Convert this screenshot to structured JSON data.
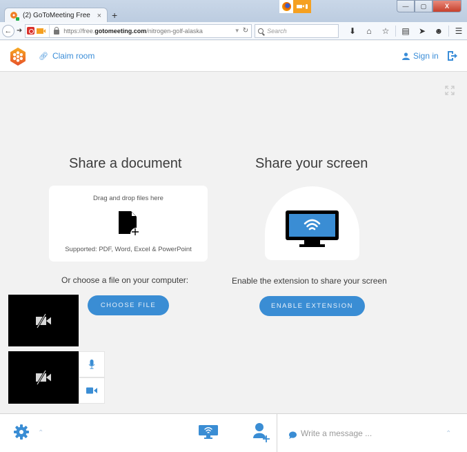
{
  "browser": {
    "tab_title": "(2) GoToMeeting Free",
    "tab_close": "×",
    "new_tab": "+",
    "url_scheme": "https://free.",
    "url_domain": "gotomeeting.com",
    "url_path": "/nitrogen-golf-alaska",
    "search_placeholder": "Search",
    "window_controls": {
      "minimize": "—",
      "maximize": "▢",
      "close": "X"
    },
    "toolbar_icons": [
      "download-icon",
      "home-icon",
      "bookmark-star-icon",
      "reading-list-icon",
      "pocket-send-icon",
      "chat-hello-icon",
      "menu-icon"
    ]
  },
  "header": {
    "claim_room": "Claim room",
    "sign_in": "Sign in"
  },
  "document": {
    "title": "Share a document",
    "drop_hint": "Drag and drop files here",
    "supported": "Supported: PDF, Word, Excel & PowerPoint",
    "or_choose": "Or choose a file on your computer:",
    "choose_button": "CHOOSE FILE"
  },
  "screen": {
    "title": "Share your screen",
    "hint": "Enable the extension to share your screen",
    "enable_button": "ENABLE EXTENSION"
  },
  "footer": {
    "chat_placeholder": "Write a message ...",
    "chevron": "^"
  },
  "colors": {
    "accent": "#3a8dd4",
    "logo_orange": "#f07a2b",
    "background": "#f2f2f2"
  }
}
